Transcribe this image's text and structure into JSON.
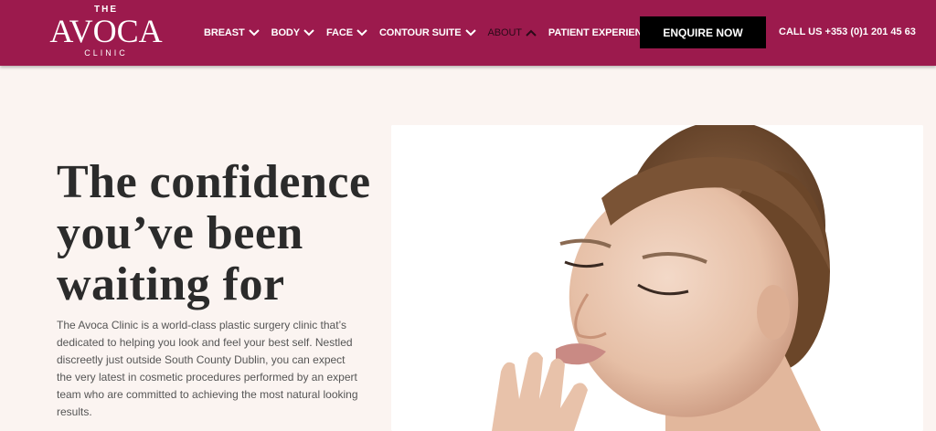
{
  "header": {
    "logo": {
      "top": "THE",
      "name": "AVOCA",
      "bottom": "CLINIC"
    },
    "nav": [
      {
        "label": "BREAST",
        "chevron": "down",
        "active": false
      },
      {
        "label": "BODY",
        "chevron": "down",
        "active": false
      },
      {
        "label": "FACE",
        "chevron": "down",
        "active": false
      },
      {
        "label": "CONTOUR SUITE",
        "chevron": "down",
        "active": false
      },
      {
        "label": "ABOUT",
        "chevron": "up",
        "active": true
      },
      {
        "label": "PATIENT EXPERIENCE & NEWS",
        "chevron": "down",
        "active": false
      }
    ],
    "enquire_label": "ENQUIRE NOW",
    "phone": "CALL US +353 (0)1 201 45 63"
  },
  "hero": {
    "headline_lines": [
      "The confidence",
      "you’ve been",
      "waiting for"
    ],
    "intro": "The Avoca Clinic is a world-class plastic surgery clinic that’s dedicated to helping you look and feel your best self. Nestled discreetly just outside South County Dublin, you can expect the very latest in cosmetic procedures performed by an expert team who are committed to achieving the most natural looking results."
  },
  "colors": {
    "header_bg": "#9c1a4d",
    "page_bg": "#fbf4f1",
    "cta_bg": "#000000"
  }
}
